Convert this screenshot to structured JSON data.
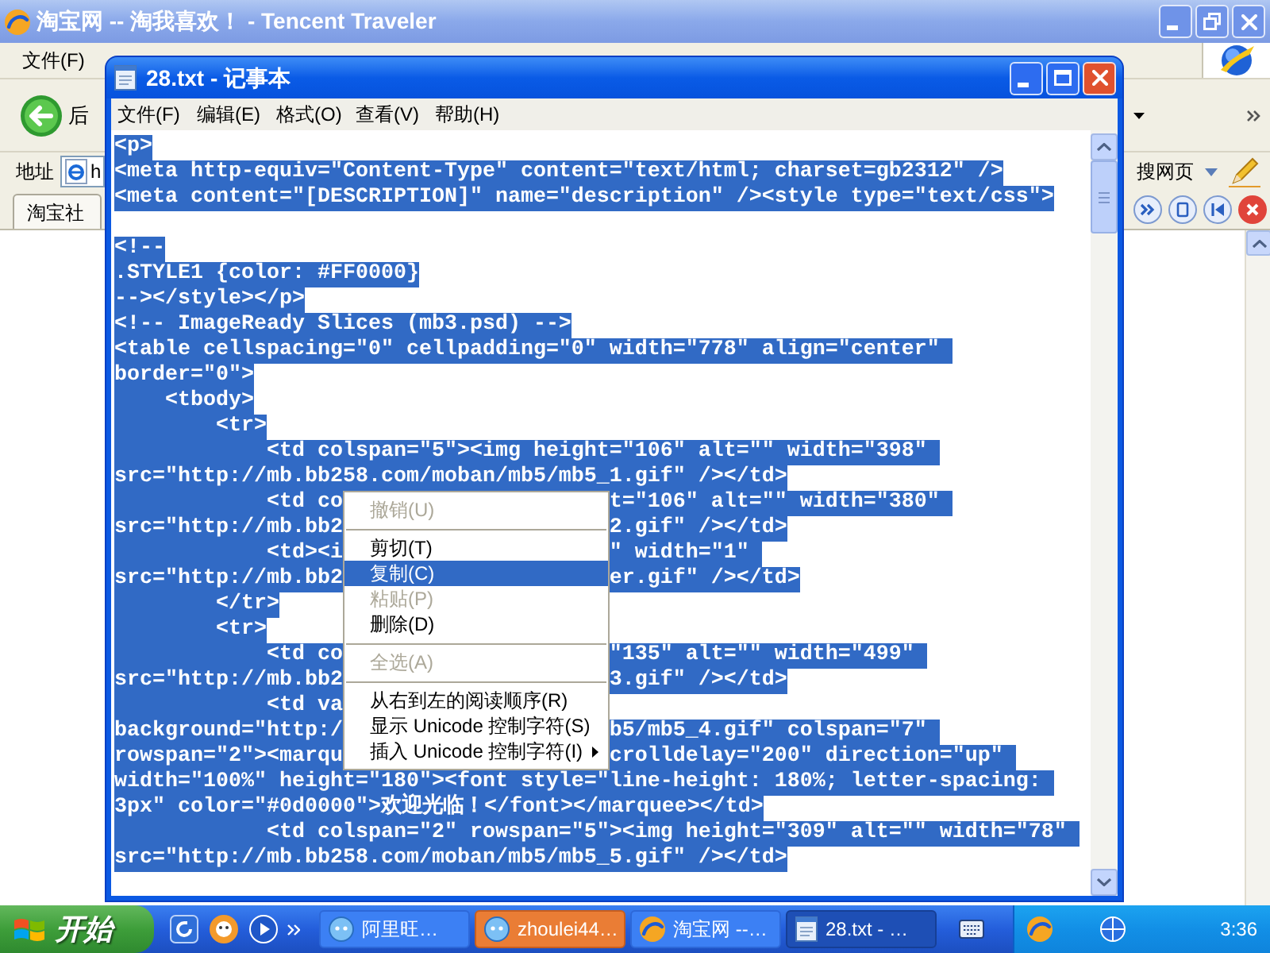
{
  "browser": {
    "title": "淘宝网 -- 淘我喜欢！ - Tencent Traveler",
    "menu": [
      "文件(F)"
    ],
    "back_label": "后",
    "address_label": "地址",
    "address_value": "h",
    "search_label": "搜网页",
    "tab": {
      "label": "淘宝社"
    }
  },
  "notepad": {
    "title": "28.txt - 记事本",
    "menu": [
      "文件(F)",
      "编辑(E)",
      "格式(O)",
      "查看(V)",
      "帮助(H)"
    ],
    "text_selected": true,
    "lines": [
      {
        "kind": "text",
        "segments": [
          "<p>"
        ]
      },
      {
        "kind": "text",
        "segments": [
          "<meta http-equiv=\"Content-Type\" content=\"text/html; charset=gb2312\" />"
        ]
      },
      {
        "kind": "text",
        "segments": [
          "<meta content=\"[DESCRIPTION]\" name=\"description\" /><style type=\"text/css\">"
        ]
      },
      {
        "kind": "blank"
      },
      {
        "kind": "text",
        "segments": [
          "<!--"
        ]
      },
      {
        "kind": "text",
        "segments": [
          ".STYLE1 {color: #FF0000}"
        ]
      },
      {
        "kind": "text",
        "segments": [
          "--></style></p>"
        ]
      },
      {
        "kind": "text",
        "segments": [
          "<!-- ImageReady Slices (mb3.psd) -->"
        ]
      },
      {
        "kind": "text",
        "segments": [
          "<table cellspacing=\"0\" cellpadding=\"0\" width=\"778\" align=\"center\" "
        ]
      },
      {
        "kind": "text",
        "segments": [
          "border=\"0\">"
        ]
      },
      {
        "kind": "text",
        "segments": [
          "    <tbody>"
        ]
      },
      {
        "kind": "text",
        "segments": [
          "        <tr>"
        ]
      },
      {
        "kind": "text",
        "segments": [
          "            <td colspan=\"5\"><img height=\"106\" alt=\"\" width=\"398\" "
        ]
      },
      {
        "kind": "text",
        "segments": [
          "src=\"http://mb.bb258.com/moban/mb5/mb5_1.gif\" /></td>"
        ]
      },
      {
        "kind": "text",
        "segments": [
          "            <td co",
          "t=\"106\" alt=\"\" width=\"380\" "
        ]
      },
      {
        "kind": "text",
        "segments": [
          "src=\"http://mb.bb2",
          "2.gif\" /></td>"
        ]
      },
      {
        "kind": "text",
        "segments": [
          "            <td><i",
          "\" width=\"1\" "
        ]
      },
      {
        "kind": "text",
        "segments": [
          "src=\"http://mb.bb2",
          "er.gif\" /></td>"
        ]
      },
      {
        "kind": "text",
        "segments": [
          "        </tr>"
        ]
      },
      {
        "kind": "text",
        "segments": [
          "        <tr>"
        ]
      },
      {
        "kind": "text",
        "segments": [
          "            <td co",
          "\"135\" alt=\"\" width=\"499\" "
        ]
      },
      {
        "kind": "text",
        "segments": [
          "src=\"http://mb.bb2",
          "3.gif\" /></td>"
        ]
      },
      {
        "kind": "text",
        "segments": [
          "            <td va"
        ]
      },
      {
        "kind": "text",
        "segments": [
          "background=\"http:/",
          "b5/mb5_4.gif\" colspan=\"7\" "
        ]
      },
      {
        "kind": "text",
        "segments": [
          "rowspan=\"2\"><marqu",
          "crolldelay=\"200\" direction=\"up\" "
        ]
      },
      {
        "kind": "text",
        "segments": [
          "width=\"100%\" height=\"180\"><font style=\"line-height: 180%; letter-spacing: "
        ]
      },
      {
        "kind": "text",
        "segments": [
          "3px\" color=\"#0d0000\">欢迎光临！</font></marquee></td>"
        ]
      },
      {
        "kind": "text",
        "segments": [
          "            <td colspan=\"2\" rowspan=\"5\"><img height=\"309\" alt=\"\" width=\"78\" "
        ]
      },
      {
        "kind": "text",
        "segments": [
          "src=\"http://mb.bb258.com/moban/mb5/mb5_5.gif\" /></td>"
        ]
      }
    ]
  },
  "context_menu": [
    {
      "kind": "item",
      "label": "撤销(U)",
      "disabled": true,
      "selected": false,
      "has_submenu": false
    },
    {
      "kind": "separator"
    },
    {
      "kind": "item",
      "label": "剪切(T)",
      "disabled": false,
      "selected": false,
      "has_submenu": false
    },
    {
      "kind": "item",
      "label": "复制(C)",
      "disabled": false,
      "selected": true,
      "has_submenu": false
    },
    {
      "kind": "item",
      "label": "粘贴(P)",
      "disabled": true,
      "selected": false,
      "has_submenu": false
    },
    {
      "kind": "item",
      "label": "删除(D)",
      "disabled": false,
      "selected": false,
      "has_submenu": false
    },
    {
      "kind": "separator"
    },
    {
      "kind": "item",
      "label": "全选(A)",
      "disabled": true,
      "selected": false,
      "has_submenu": false
    },
    {
      "kind": "separator"
    },
    {
      "kind": "item",
      "label": "从右到左的阅读顺序(R)",
      "disabled": false,
      "selected": false,
      "has_submenu": false
    },
    {
      "kind": "item",
      "label": "显示 Unicode 控制字符(S)",
      "disabled": false,
      "selected": false,
      "has_submenu": false
    },
    {
      "kind": "item",
      "label": "插入 Unicode 控制字符(I)",
      "disabled": false,
      "selected": false,
      "has_submenu": true
    }
  ],
  "taskbar": {
    "start_label": "开始",
    "tasks": [
      {
        "label": "阿里旺…",
        "selected": false,
        "flashing": false
      },
      {
        "label": "zhoulei44…",
        "selected": false,
        "flashing": true
      },
      {
        "label": "淘宝网 --…",
        "selected": false,
        "flashing": false
      },
      {
        "label": "28.txt - …",
        "selected": true,
        "flashing": false
      }
    ],
    "clock": "3:36"
  }
}
